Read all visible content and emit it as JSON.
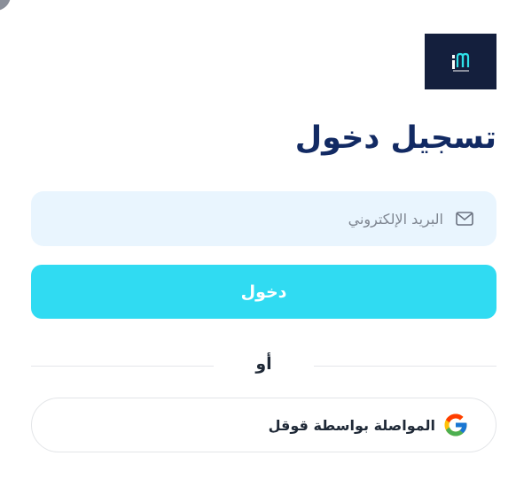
{
  "logo": {
    "icon": "brand-logo-icon",
    "background": "#141f3d",
    "accent": "#2ee0e8"
  },
  "page": {
    "title": "تسجيل دخول",
    "title_color": "#122a63"
  },
  "email": {
    "placeholder": "البريد الإلكتروني",
    "value": "",
    "icon": "mail-icon",
    "background": "#e9f5fe"
  },
  "login_button": {
    "label": "دخول",
    "color": "#30dbf2"
  },
  "divider": {
    "text": "أو"
  },
  "google_button": {
    "label": "المواصلة بواسطة قوقل",
    "icon": "google-icon"
  },
  "decorations": {
    "corner": "corner-shape"
  }
}
